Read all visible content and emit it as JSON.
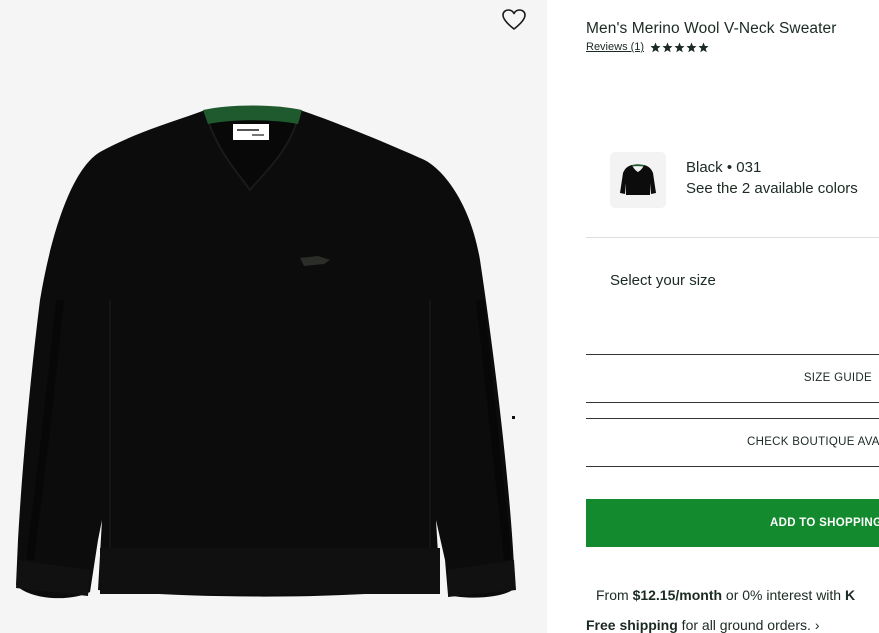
{
  "product": {
    "title": "Men's Merino Wool V-Neck Sweater",
    "reviews_label": "Reviews (1)",
    "rating_stars": 5
  },
  "icons": {
    "wishlist": "heart-outline-icon",
    "rating": "star-icon",
    "chevron": "chevron-right-icon"
  },
  "color": {
    "selected": "Black • 031",
    "colors_link": "See the 2 available colors"
  },
  "size": {
    "label": "Select your size",
    "guide_label": "SIZE GUIDE",
    "boutique_label": "CHECK BOUTIQUE AVA"
  },
  "cart": {
    "add_label": "ADD TO SHOPPING"
  },
  "financing": {
    "prefix": "From ",
    "amount": "$12.15/month",
    "suffix": " or 0% interest with ",
    "provider": "K"
  },
  "shipping": {
    "bold": "Free shipping",
    "rest": " for all ground orders.",
    "chevron": "›"
  },
  "colors": {
    "accent_green": "#138a2d",
    "collar_green": "#1f5a2e",
    "text": "#1b2a22",
    "image_bg": "#f5f5f5"
  }
}
